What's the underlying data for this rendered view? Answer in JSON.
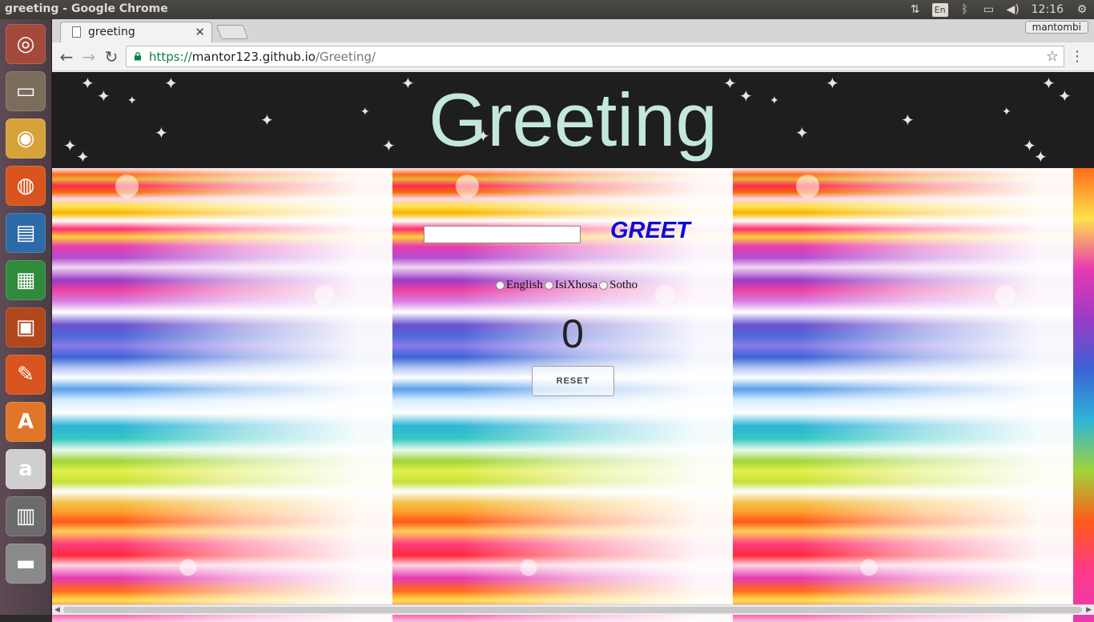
{
  "window": {
    "title": "greeting - Google Chrome"
  },
  "tray": {
    "keyboard": "En",
    "time": "12:16"
  },
  "launcher": {
    "items": [
      {
        "name": "ubuntu-dash",
        "glyph": "◎",
        "color": "#a44a3a"
      },
      {
        "name": "files",
        "glyph": "▭",
        "color": "#7a6d5c"
      },
      {
        "name": "chrome",
        "glyph": "◉",
        "color": "#d8a23a"
      },
      {
        "name": "firefox",
        "glyph": "◍",
        "color": "#d9541e"
      },
      {
        "name": "writer",
        "glyph": "▤",
        "color": "#2d6aa8"
      },
      {
        "name": "calc",
        "glyph": "▦",
        "color": "#2f8a3c"
      },
      {
        "name": "impress",
        "glyph": "▣",
        "color": "#b0471d"
      },
      {
        "name": "inkscape",
        "glyph": "✎",
        "color": "#d9541e"
      },
      {
        "name": "software-center",
        "glyph": "A",
        "color": "#e0762a"
      },
      {
        "name": "amazon",
        "glyph": "a",
        "color": "#cfcfcf"
      },
      {
        "name": "workspace-switcher",
        "glyph": "▥",
        "color": "#6b6b6b"
      },
      {
        "name": "trash",
        "glyph": "▬",
        "color": "#8a8a8a"
      }
    ]
  },
  "browser": {
    "tab_title": "greeting",
    "profile": "mantombi",
    "url_scheme": "https://",
    "url_host": "mantor123.github.io",
    "url_path": "/Greeting/"
  },
  "page": {
    "heading": "Greeting",
    "greet_label": "GREET",
    "name_input_value": "",
    "languages": [
      "English",
      "IsiXhosa",
      "Sotho"
    ],
    "counter": "0",
    "reset_label": "RESET"
  }
}
